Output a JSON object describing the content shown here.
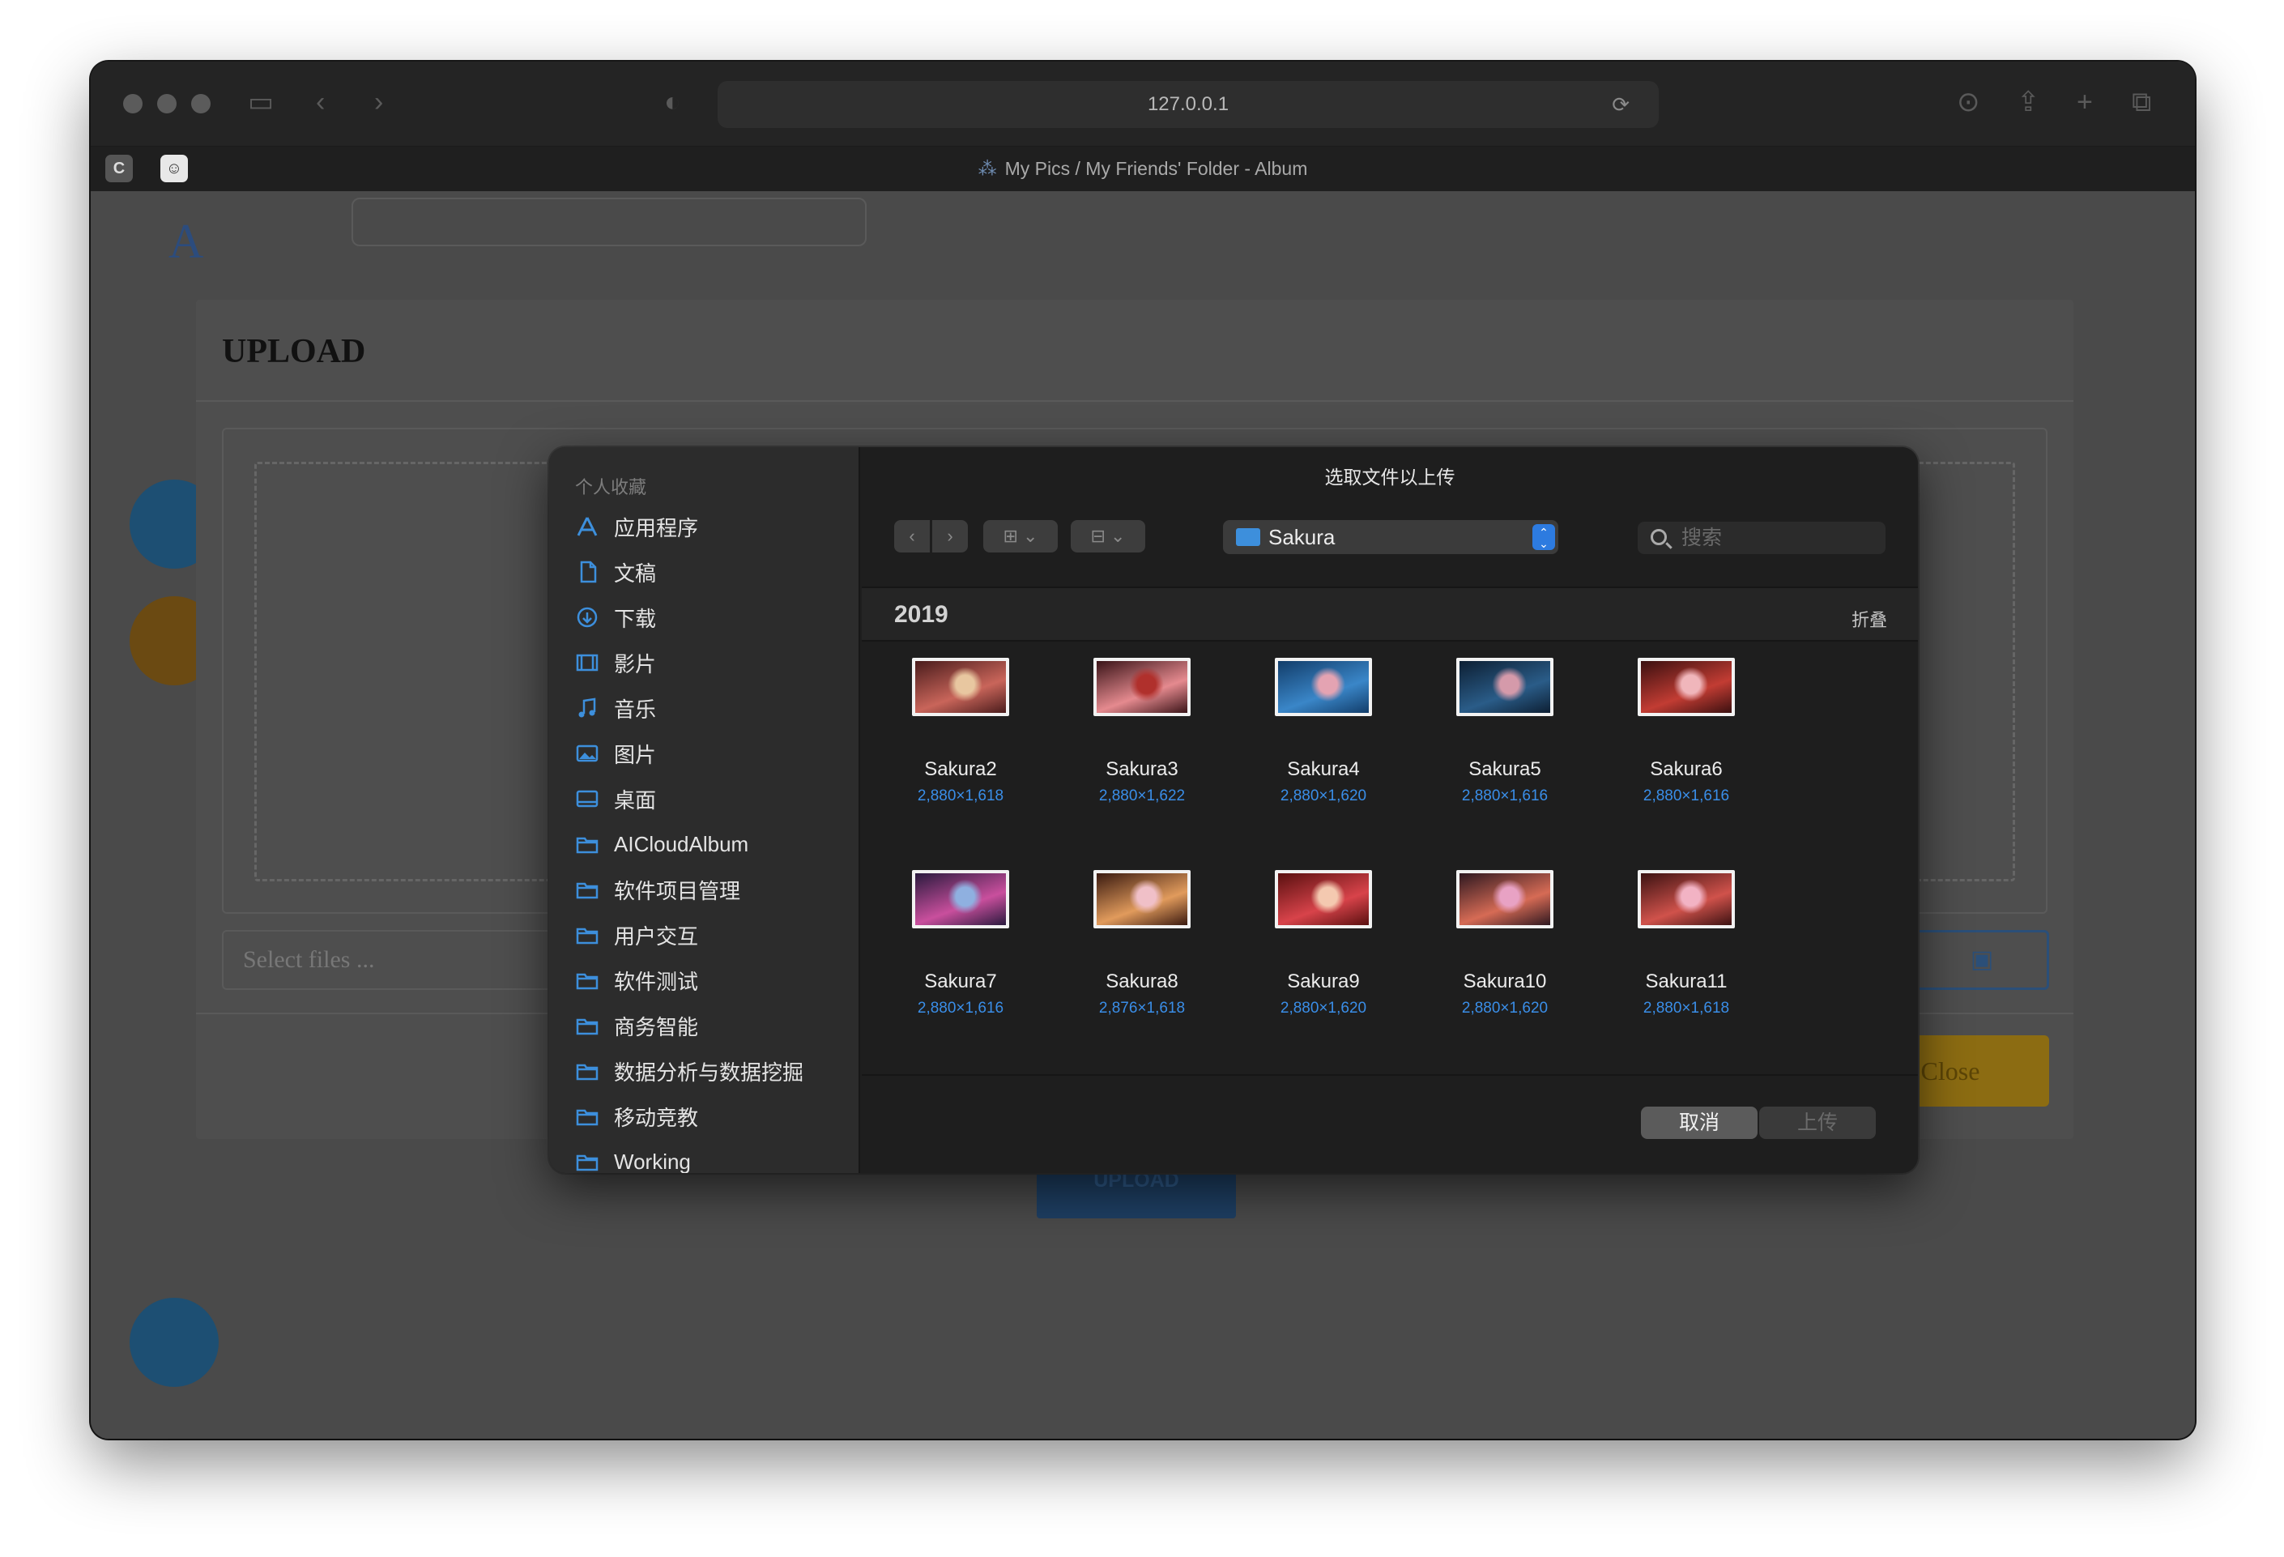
{
  "browser": {
    "url": "127.0.0.1",
    "tab_title": "My Pics / My Friends' Folder - Album",
    "tab_favicon_label": "C"
  },
  "page": {
    "logo_text": "A",
    "upload_button": "UPLOAD"
  },
  "upload_modal": {
    "title": "UPLOAD",
    "input_placeholder": "Select files ...",
    "close_label": "Close",
    "browse_icon": "image-icon"
  },
  "dialog": {
    "title": "选取文件以上传",
    "sidebar_section": "个人收藏",
    "sidebar_items": [
      {
        "label": "应用程序",
        "icon": "apps-icon"
      },
      {
        "label": "文稿",
        "icon": "document-icon"
      },
      {
        "label": "下载",
        "icon": "download-icon"
      },
      {
        "label": "影片",
        "icon": "film-icon"
      },
      {
        "label": "音乐",
        "icon": "music-icon"
      },
      {
        "label": "图片",
        "icon": "photo-icon"
      },
      {
        "label": "桌面",
        "icon": "desktop-icon"
      },
      {
        "label": "AICloudAlbum",
        "icon": "folder-icon"
      },
      {
        "label": "软件项目管理",
        "icon": "folder-icon"
      },
      {
        "label": "用户交互",
        "icon": "folder-icon"
      },
      {
        "label": "软件测试",
        "icon": "folder-icon"
      },
      {
        "label": "商务智能",
        "icon": "folder-icon"
      },
      {
        "label": "数据分析与数据挖掘",
        "icon": "folder-icon"
      },
      {
        "label": "移动竞教",
        "icon": "folder-icon"
      },
      {
        "label": "Working",
        "icon": "folder-icon"
      }
    ],
    "current_folder": "Sakura",
    "search_placeholder": "搜索",
    "group_year": "2019",
    "group_collapse": "折叠",
    "files": [
      {
        "name": "Sakura2",
        "dims": "2,880×1,618",
        "colors": [
          "#4a1c1c",
          "#c9655a",
          "#e8c7a0"
        ]
      },
      {
        "name": "Sakura3",
        "dims": "2,880×1,622",
        "colors": [
          "#3a1418",
          "#e58a8f",
          "#b0302c"
        ]
      },
      {
        "name": "Sakura4",
        "dims": "2,880×1,620",
        "colors": [
          "#123d6a",
          "#3a86c8",
          "#e4a3b2"
        ]
      },
      {
        "name": "Sakura5",
        "dims": "2,880×1,616",
        "colors": [
          "#0d1f33",
          "#2a5c88",
          "#d59aaa"
        ]
      },
      {
        "name": "Sakura6",
        "dims": "2,880×1,616",
        "colors": [
          "#3b1010",
          "#c23c33",
          "#f0b6bb"
        ]
      },
      {
        "name": "Sakura7",
        "dims": "2,880×1,616",
        "colors": [
          "#2a1a3e",
          "#c94f9d",
          "#8fb0e0"
        ]
      },
      {
        "name": "Sakura8",
        "dims": "2,876×1,618",
        "colors": [
          "#3a1a10",
          "#e19b5c",
          "#f0c0c8"
        ]
      },
      {
        "name": "Sakura9",
        "dims": "2,880×1,620",
        "colors": [
          "#5a1010",
          "#d8434a",
          "#f4c9b0"
        ]
      },
      {
        "name": "Sakura10",
        "dims": "2,880×1,620",
        "colors": [
          "#2e1820",
          "#d66b55",
          "#e8a2c4"
        ]
      },
      {
        "name": "Sakura11",
        "dims": "2,880×1,618",
        "colors": [
          "#3c1212",
          "#d0524b",
          "#f2b3c4"
        ]
      }
    ],
    "cancel_label": "取消",
    "upload_label": "上传"
  }
}
